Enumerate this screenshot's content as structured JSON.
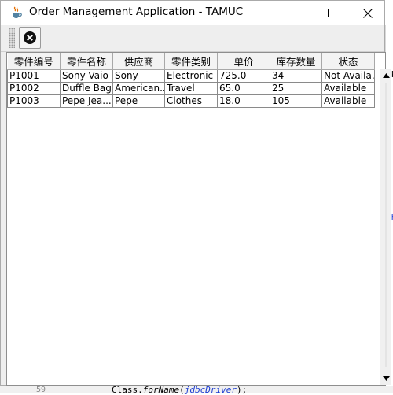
{
  "window": {
    "title": "Order Management Application - TAMUC"
  },
  "toolbar": {
    "close_icon": "close-circle-icon"
  },
  "table": {
    "columns": [
      "零件编号",
      "零件名称",
      "供应商",
      "零件类别",
      "单价",
      "库存数量",
      "状态"
    ],
    "rows": [
      [
        "P1001",
        "Sony Vaio",
        "Sony",
        "Electronic",
        "725.0",
        "34",
        "Not Availa..."
      ],
      [
        "P1002",
        "Duffle Bag",
        "American...",
        "Travel",
        "65.0",
        "25",
        "Available"
      ],
      [
        "P1003",
        "Pepe Jea...",
        "Pepe",
        "Clothes",
        "18.0",
        "105",
        "Available"
      ]
    ]
  },
  "background": {
    "right_fragment_top": "ck",
    "right_fragment_mid": "ch",
    "line_number": "59",
    "code_prefix": "Class.",
    "code_method": "forName",
    "code_arg": "jdbcDriver",
    "code_suffix": ");"
  },
  "colors": {
    "code_variable": "#1a3bd1",
    "header_bg": "#f3f3f3",
    "window_bg": "#eeeeee"
  }
}
